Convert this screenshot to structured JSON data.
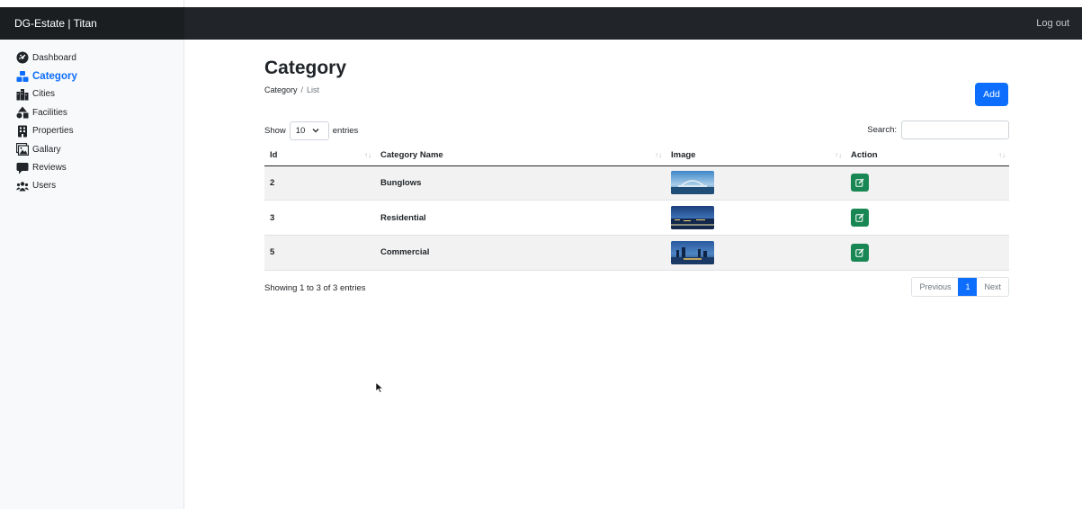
{
  "app": {
    "brand": "DG-Estate | Titan",
    "logout_label": "Log out"
  },
  "sidebar": {
    "items": [
      {
        "label": "Dashboard",
        "icon": "dashboard-icon"
      },
      {
        "label": "Category",
        "icon": "category-icon",
        "active": true
      },
      {
        "label": "Cities",
        "icon": "city-icon"
      },
      {
        "label": "Facilities",
        "icon": "facilities-icon"
      },
      {
        "label": "Properties",
        "icon": "building-icon"
      },
      {
        "label": "Gallary",
        "icon": "gallery-icon"
      },
      {
        "label": "Reviews",
        "icon": "comment-icon"
      },
      {
        "label": "Users",
        "icon": "users-icon"
      }
    ]
  },
  "page": {
    "title": "Category",
    "breadcrumb": [
      "Category",
      "List"
    ],
    "add_label": "Add"
  },
  "table_controls": {
    "show_label": "Show",
    "page_length": "10",
    "entries_label": "entries",
    "search_label": "Search:",
    "search_value": ""
  },
  "table": {
    "columns": [
      "Id",
      "Category Name",
      "Image",
      "Action"
    ],
    "rows": [
      {
        "id": "2",
        "name": "Bunglows",
        "image": "bunglows-thumbnail"
      },
      {
        "id": "3",
        "name": "Residential",
        "image": "residential-thumbnail"
      },
      {
        "id": "5",
        "name": "Commercial",
        "image": "commercial-thumbnail"
      }
    ]
  },
  "footer": {
    "info": "Showing 1 to 3 of 3 entries",
    "previous_label": "Previous",
    "current_page": "1",
    "next_label": "Next"
  },
  "colors": {
    "primary": "#0d6efd",
    "success": "#198754",
    "navbar": "#212529"
  }
}
